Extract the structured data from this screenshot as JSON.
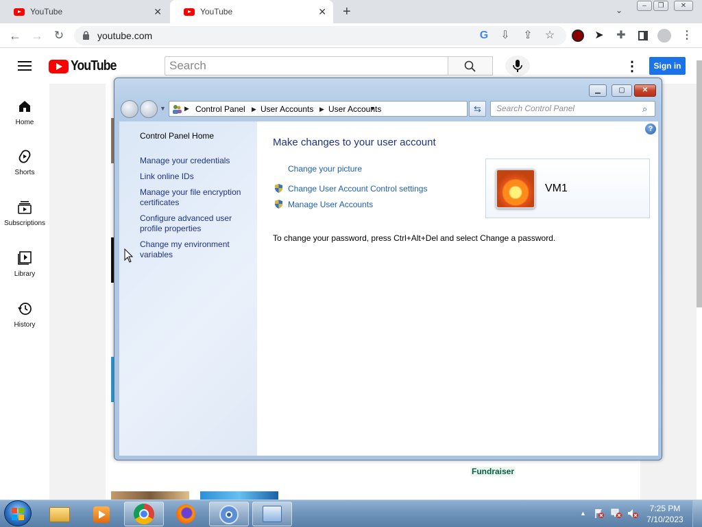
{
  "browser": {
    "tabs": [
      {
        "title": "YouTube",
        "active": false
      },
      {
        "title": "YouTube",
        "active": true
      }
    ],
    "url": "youtube.com"
  },
  "youtube": {
    "logo_text": "YouTube",
    "search_placeholder": "Search",
    "signin_label": "Sign in",
    "sidebar": [
      {
        "label": "Home",
        "icon": "home-icon"
      },
      {
        "label": "Shorts",
        "icon": "shorts-icon"
      },
      {
        "label": "Subscriptions",
        "icon": "subscriptions-icon"
      },
      {
        "label": "Library",
        "icon": "library-icon"
      },
      {
        "label": "History",
        "icon": "history-icon"
      }
    ],
    "fundraiser_label": "Fundraiser"
  },
  "control_panel": {
    "breadcrumb": [
      "Control Panel",
      "User Accounts",
      "User Accounts"
    ],
    "search_placeholder": "Search Control Panel",
    "left_tasks": {
      "home": "Control Panel Home",
      "items": [
        "Manage your credentials",
        "Link online IDs",
        "Manage your file encryption certificates",
        "Configure advanced user profile properties",
        "Change my environment variables"
      ]
    },
    "heading": "Make changes to your user account",
    "links": {
      "change_picture": "Change your picture",
      "uac_settings": "Change User Account Control settings",
      "manage_accounts": "Manage User Accounts"
    },
    "account_name": "VM1",
    "password_hint": "To change your password, press Ctrl+Alt+Del and select Change a password."
  },
  "taskbar": {
    "time": "7:25 PM",
    "date": "7/10/2023"
  },
  "colors": {
    "youtube_red": "#ff0000",
    "signin_blue": "#1a73e8",
    "cp_link": "#1e5fb4",
    "cp_heading": "#1e3287"
  }
}
